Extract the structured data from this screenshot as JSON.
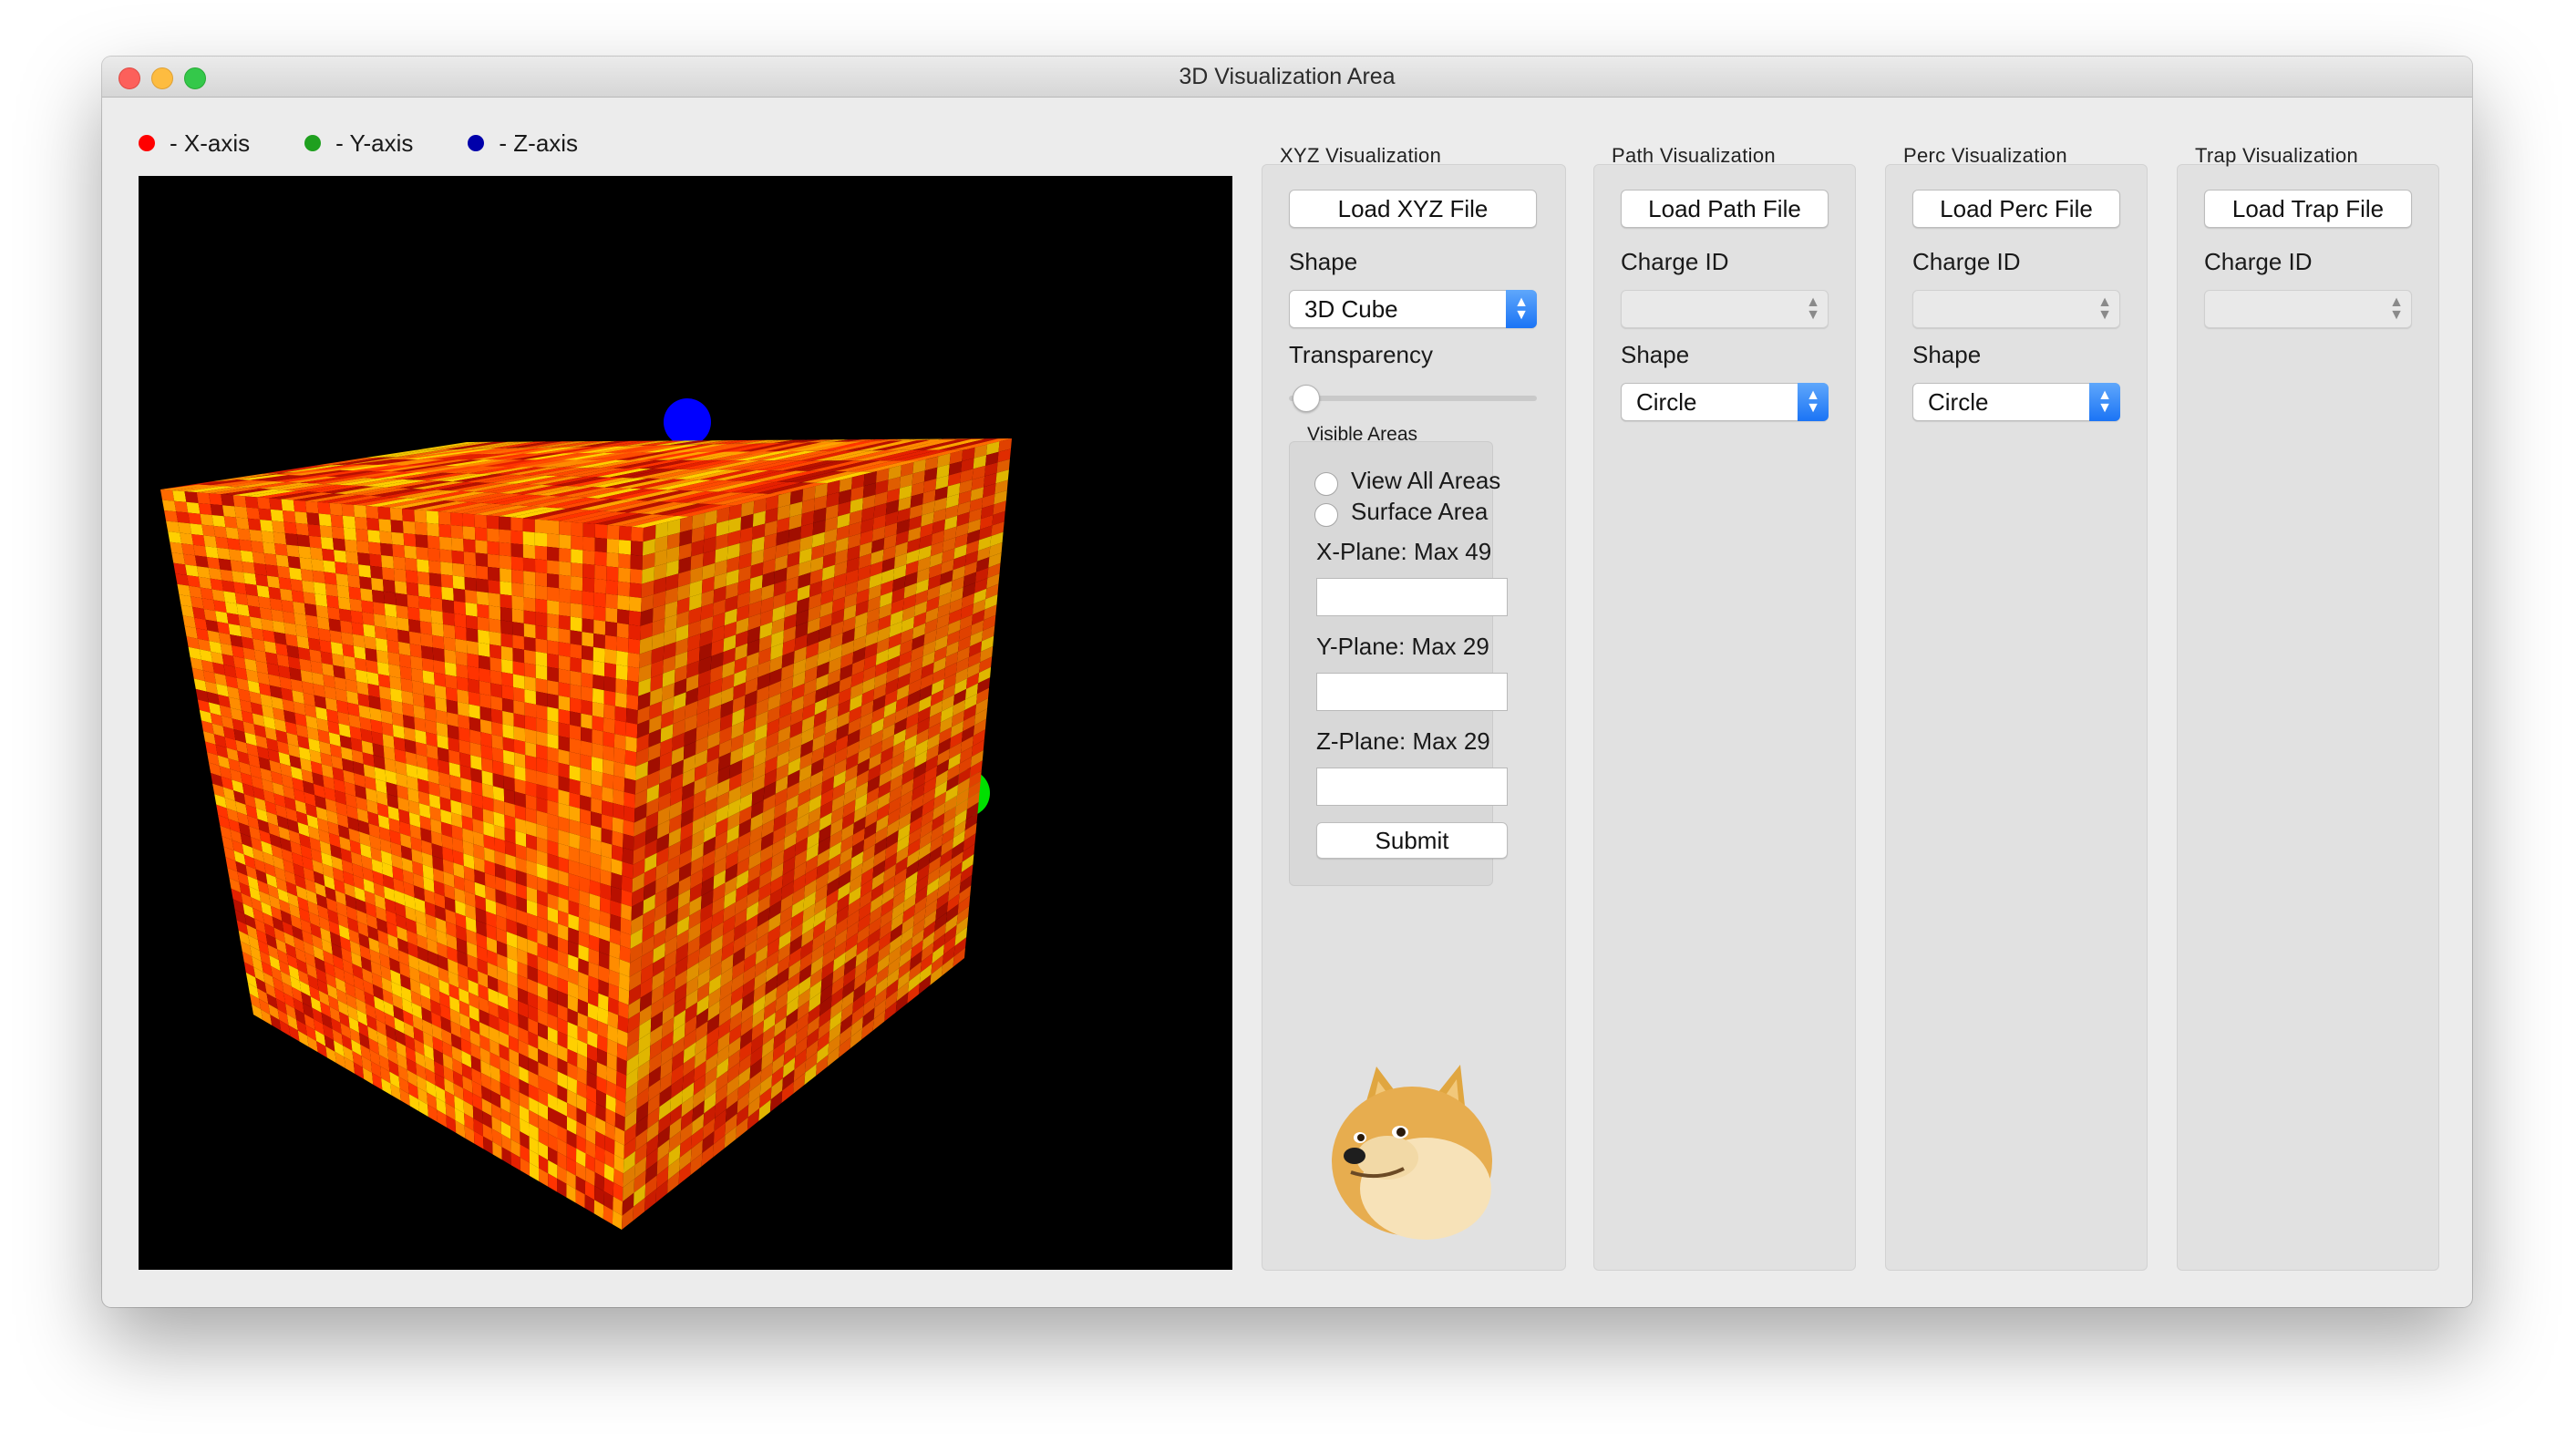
{
  "window": {
    "title": "3D Visualization Area"
  },
  "legend": [
    {
      "label": "- X-axis",
      "color": "#ff0000"
    },
    {
      "label": "- Y-axis",
      "color": "#1fa01f"
    },
    {
      "label": "- Z-axis",
      "color": "#0000aa"
    }
  ],
  "axis_markers": {
    "z_color": "#0000ff",
    "y_color": "#00e000"
  },
  "xyz": {
    "title": "XYZ Visualization",
    "load_label": "Load XYZ File",
    "shape_label": "Shape",
    "shape_value": "3D Cube",
    "transparency_label": "Transparency",
    "transparency_value": 0,
    "visible_areas": {
      "title": "Visible Areas",
      "options": [
        "View All Areas",
        "Surface Area"
      ],
      "x_plane_label": "X-Plane: Max 49",
      "y_plane_label": "Y-Plane: Max 29",
      "z_plane_label": "Z-Plane: Max 29",
      "x_plane_value": "",
      "y_plane_value": "",
      "z_plane_value": "",
      "submit_label": "Submit"
    }
  },
  "path": {
    "title": "Path Visualization",
    "load_label": "Load Path File",
    "charge_label": "Charge ID",
    "charge_value": "",
    "shape_label": "Shape",
    "shape_value": "Circle"
  },
  "perc": {
    "title": "Perc Visualization",
    "load_label": "Load Perc File",
    "charge_label": "Charge ID",
    "charge_value": "",
    "shape_label": "Shape",
    "shape_value": "Circle"
  },
  "trap": {
    "title": "Trap Visualization",
    "load_label": "Load Trap File",
    "charge_label": "Charge ID",
    "charge_value": ""
  },
  "palette": [
    "#ff4a00",
    "#ff6a00",
    "#ff8c00",
    "#ffa500",
    "#ff3300",
    "#e62000",
    "#ffd000",
    "#b81000",
    "#ff5a00"
  ]
}
